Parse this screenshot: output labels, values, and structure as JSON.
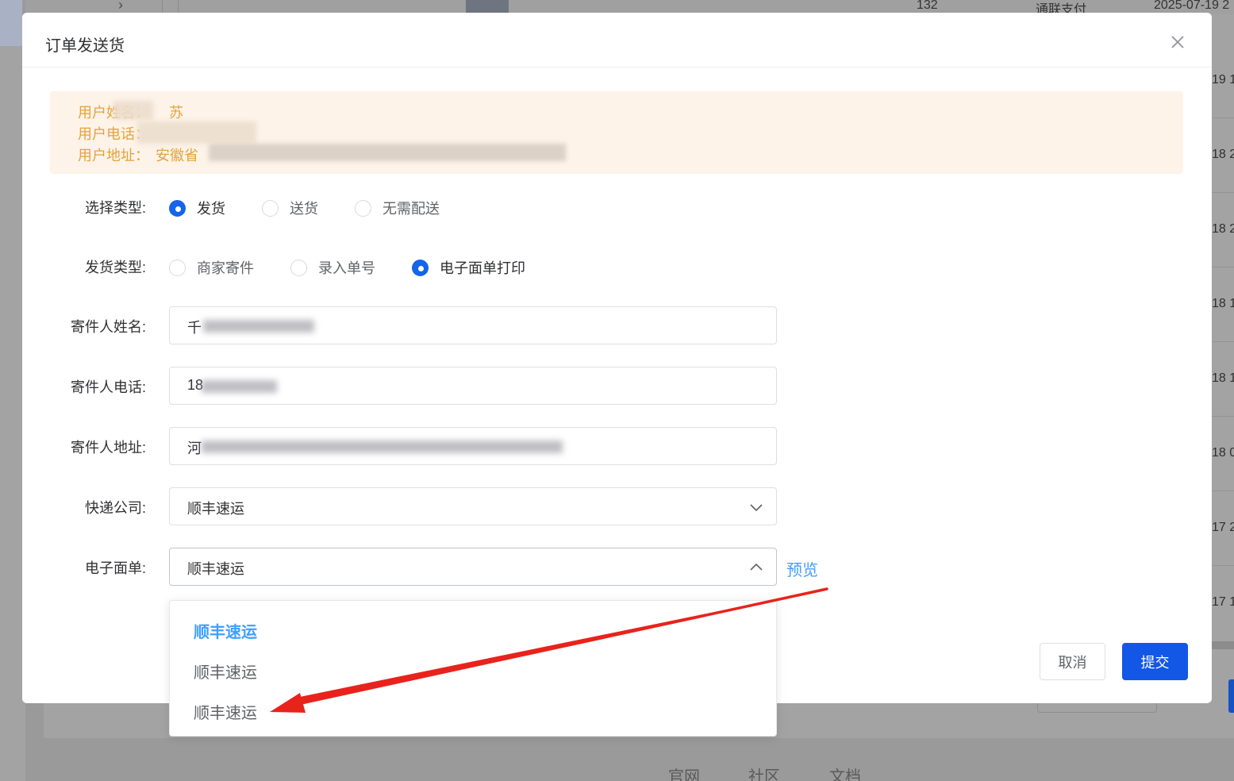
{
  "background": {
    "row": {
      "amount": "132",
      "payment": "通联支付",
      "date": "2025-07-19 2"
    },
    "right_column": [
      "19 1",
      "18 2",
      "18 2",
      "18 1",
      "18 1",
      "18 0",
      "17 2",
      "17 1"
    ],
    "footer_links": [
      "官网",
      "社区",
      "文档"
    ]
  },
  "dialog": {
    "title": "订单发送货",
    "alert": {
      "name_label": "用户姓名：",
      "name_value": "苏",
      "phone_label": "用户电话：",
      "address_label": "用户地址：",
      "address_value": "安徽省"
    },
    "form": {
      "select_type": {
        "label": "选择类型:",
        "options": [
          "发货",
          "送货",
          "无需配送"
        ],
        "selected": "发货"
      },
      "delivery_type": {
        "label": "发货类型:",
        "options": [
          "商家寄件",
          "录入单号",
          "电子面单打印"
        ],
        "selected": "电子面单打印"
      },
      "sender_name": {
        "label": "寄件人姓名:",
        "value": "千"
      },
      "sender_phone": {
        "label": "寄件人电话:",
        "value": "18"
      },
      "sender_address": {
        "label": "寄件人地址:",
        "value": "河"
      },
      "courier": {
        "label": "快递公司:",
        "value": "顺丰速运"
      },
      "waybill": {
        "label": "电子面单:",
        "value": "顺丰速运",
        "preview": "预览",
        "options": [
          "顺丰速运",
          "顺丰速运",
          "顺丰速运"
        ]
      }
    },
    "buttons": {
      "cancel": "取消",
      "submit": "提交"
    }
  },
  "colors": {
    "primary": "#1257e6",
    "radio_checked": "#1565e8",
    "link": "#409eff",
    "warning_text": "#e6a23c",
    "warning_bg": "#fdf3e8",
    "annotation_arrow": "#e8231c"
  }
}
